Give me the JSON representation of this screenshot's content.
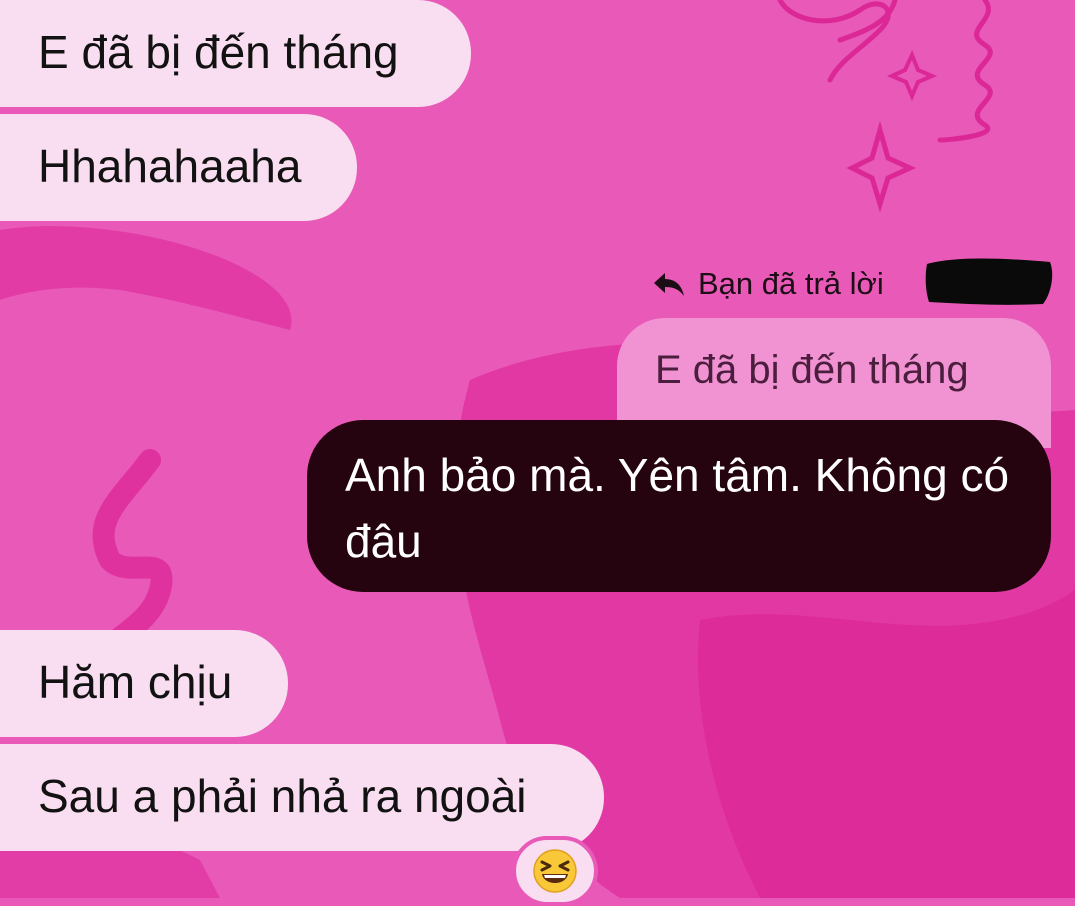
{
  "messages": {
    "incoming_1": "E đã bị đến tháng",
    "incoming_2": "Hhahahaaha",
    "reply_label": "Bạn đã trả lời",
    "quoted_text": "E đã bị đến tháng",
    "outgoing_1": "Anh bảo mà. Yên tâm. Không có đâu",
    "incoming_3": "Hăm chịu",
    "incoming_4": "Sau a phải nhả ra ngoài"
  },
  "reaction": {
    "icon": "grinning-squinting-face-emoji"
  },
  "colors": {
    "background": "#e859b8",
    "incoming_bubble": "#f9ddf0",
    "outgoing_bubble": "#25040f",
    "quoted_bubble": "#f192d3",
    "decoration": "#e0329f"
  }
}
